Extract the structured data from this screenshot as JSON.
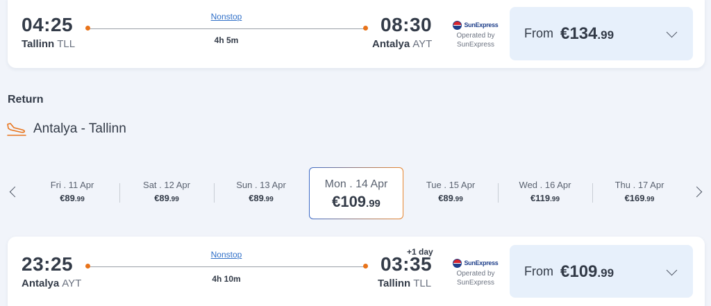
{
  "outbound": {
    "depart_time": "04:25",
    "depart_city": "Tallinn",
    "depart_code": "TLL",
    "arrive_time": "08:30",
    "arrive_city": "Antalya",
    "arrive_code": "AYT",
    "stops": "Nonstop",
    "duration": "4h 5m",
    "airline_logo": "SunExpress",
    "operated_by": "Operated by",
    "airline": "SunExpress",
    "from_label": "From",
    "price_main": "€134",
    "price_cents": ".99"
  },
  "return_section": {
    "heading": "Return",
    "route": "Antalya - Tallinn",
    "icon": "plane-landing-icon"
  },
  "dates": [
    {
      "label": "Fri . 11 Apr",
      "price_main": "€89",
      "price_cents": ".99"
    },
    {
      "label": "Sat . 12 Apr",
      "price_main": "€89",
      "price_cents": ".99"
    },
    {
      "label": "Sun . 13 Apr",
      "price_main": "€89",
      "price_cents": ".99"
    },
    {
      "label": "Mon . 14 Apr",
      "price_main": "€109",
      "price_cents": ".99"
    },
    {
      "label": "Tue . 15 Apr",
      "price_main": "€89",
      "price_cents": ".99"
    },
    {
      "label": "Wed . 16 Apr",
      "price_main": "€119",
      "price_cents": ".99"
    },
    {
      "label": "Thu . 17 Apr",
      "price_main": "€169",
      "price_cents": ".99"
    }
  ],
  "inbound": {
    "depart_time": "23:25",
    "depart_city": "Antalya",
    "depart_code": "AYT",
    "arrive_time": "03:35",
    "arrive_city": "Tallinn",
    "arrive_code": "TLL",
    "plus_day": "+1 day",
    "stops": "Nonstop",
    "duration": "4h 10m",
    "airline_logo": "SunExpress",
    "operated_by": "Operated by",
    "airline": "SunExpress",
    "from_label": "From",
    "price_main": "€109",
    "price_cents": ".99"
  },
  "colors": {
    "accent_orange": "#e8731a",
    "link_blue": "#2f6fc8",
    "price_box_bg": "#e7f0fb",
    "page_bg": "#f1f4fa"
  }
}
